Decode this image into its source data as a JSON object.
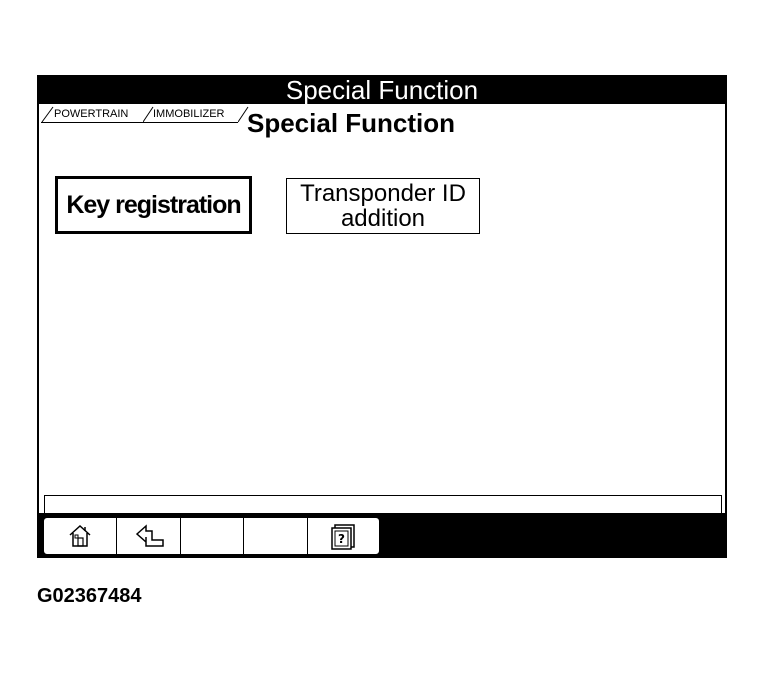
{
  "window": {
    "title": "Special Function"
  },
  "breadcrumb": {
    "items": [
      {
        "label": "POWERTRAIN"
      },
      {
        "label": "IMMOBILIZER"
      }
    ]
  },
  "page": {
    "title": "Special Function"
  },
  "functions": {
    "key_registration": "Key registration",
    "transponder_line1": "Transponder ID",
    "transponder_line2": "addition"
  },
  "toolbar": {
    "icons": [
      "home-icon",
      "back-icon",
      "help-icon"
    ]
  },
  "figure": {
    "id": "G02367484"
  }
}
